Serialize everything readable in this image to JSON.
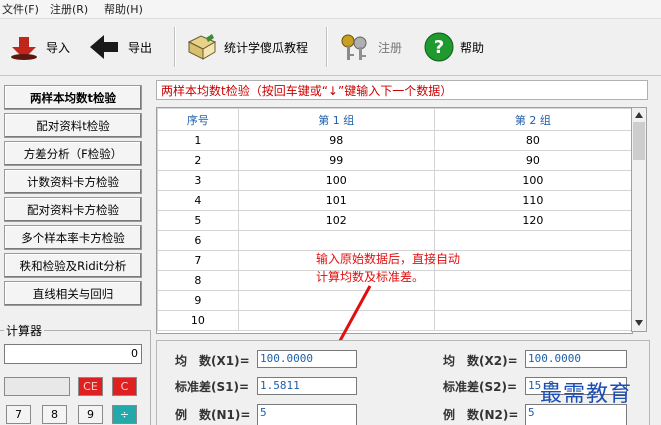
{
  "menu": {
    "items": [
      "文件(F)",
      "注册(R)",
      "帮助(H)"
    ]
  },
  "toolbar": {
    "import_label": "导入",
    "export_label": "导出",
    "tutorial_label": "统计学傻瓜教程",
    "register_label": "注册",
    "help_label": "帮助"
  },
  "sidebar": {
    "items": [
      {
        "label": "两样本均数t检验"
      },
      {
        "label": "配对资料t检验"
      },
      {
        "label": "方差分析（F检验）"
      },
      {
        "label": "计数资料卡方检验"
      },
      {
        "label": "配对资料卡方检验"
      },
      {
        "label": "多个样本率卡方检验"
      },
      {
        "label": "秩和检验及Ridit分析"
      },
      {
        "label": "直线相关与回归"
      }
    ]
  },
  "main": {
    "title": "两样本均数t检验（按回车键或“↓”键输入下一个数据）",
    "table": {
      "headers": [
        "序号",
        "第 1 组",
        "第 2 组"
      ],
      "rows": [
        [
          "1",
          "98",
          "80"
        ],
        [
          "2",
          "99",
          "90"
        ],
        [
          "3",
          "100",
          "100"
        ],
        [
          "4",
          "101",
          "110"
        ],
        [
          "5",
          "102",
          "120"
        ],
        [
          "6",
          "",
          ""
        ],
        [
          "7",
          "",
          ""
        ],
        [
          "8",
          "",
          ""
        ],
        [
          "9",
          "",
          ""
        ],
        [
          "10",
          "",
          ""
        ]
      ]
    },
    "annotation": [
      "输入原始数据后，直接自动",
      "计算均数及标准差。"
    ]
  },
  "stats": {
    "mean1_label": "均　数(X1)=",
    "mean1_value": "100.0000",
    "sd1_label": "标准差(S1)=",
    "sd1_value": "1.5811",
    "n1_label": "例　数(N1)=",
    "n1_value": "5",
    "mean2_label": "均　数(X2)=",
    "mean2_value": "100.0000",
    "sd2_label": "标准差(S2)=",
    "sd2_value": "15.8",
    "n2_label": "例　数(N2)=",
    "n2_value": "5"
  },
  "calculator": {
    "title": "计算器",
    "display_value": "0",
    "ce_label": "CE",
    "c_label": "C",
    "keys": [
      "7",
      "8",
      "9",
      "÷"
    ]
  },
  "watermark": "最需教育",
  "colors": {
    "title_red": "#cc0000",
    "value_blue": "#1f5faa",
    "calc_red": "#e02020",
    "calc_teal": "#22aaaa"
  }
}
